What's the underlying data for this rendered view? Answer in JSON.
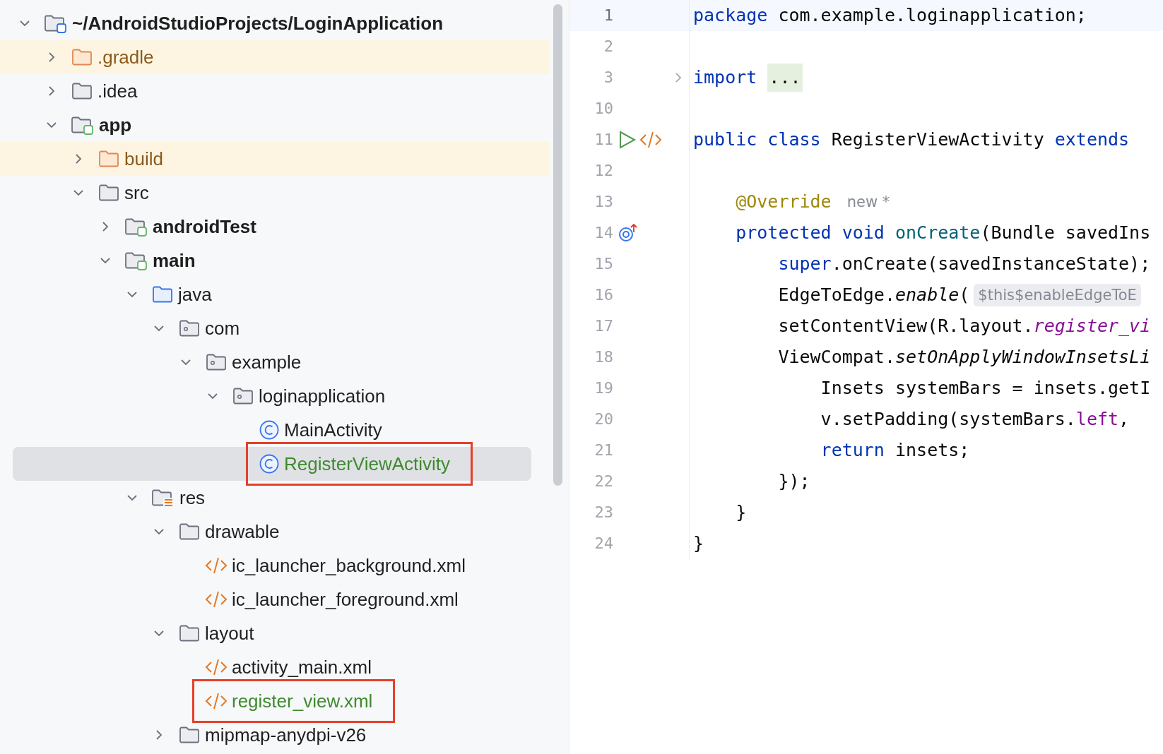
{
  "project_tree": {
    "root": {
      "label": "~/AndroidStudioProjects/LoginApplication",
      "kind": "project",
      "expanded": true,
      "excluded": false,
      "selected": false,
      "added": false,
      "boxed": false,
      "children": [
        {
          "label": ".gradle",
          "kind": "folder",
          "expanded": false,
          "excluded": true,
          "selected": false,
          "added": false,
          "boxed": false
        },
        {
          "label": ".idea",
          "kind": "folder",
          "expanded": false,
          "excluded": false,
          "selected": false,
          "added": false,
          "boxed": false
        },
        {
          "label": "app",
          "kind": "module",
          "expanded": true,
          "excluded": false,
          "selected": false,
          "added": false,
          "boxed": false,
          "children": [
            {
              "label": "build",
              "kind": "folder",
              "expanded": false,
              "excluded": true,
              "selected": false,
              "added": false,
              "boxed": false
            },
            {
              "label": "src",
              "kind": "folder",
              "expanded": true,
              "excluded": false,
              "selected": false,
              "added": false,
              "boxed": false,
              "children": [
                {
                  "label": "androidTest",
                  "kind": "module",
                  "expanded": false,
                  "excluded": false,
                  "selected": false,
                  "added": false,
                  "boxed": false
                },
                {
                  "label": "main",
                  "kind": "module",
                  "expanded": true,
                  "excluded": false,
                  "selected": false,
                  "added": false,
                  "boxed": false,
                  "children": [
                    {
                      "label": "java",
                      "kind": "source-root",
                      "expanded": true,
                      "excluded": false,
                      "selected": false,
                      "added": false,
                      "boxed": false,
                      "children": [
                        {
                          "label": "com",
                          "kind": "package",
                          "expanded": true,
                          "excluded": false,
                          "selected": false,
                          "added": false,
                          "boxed": false,
                          "children": [
                            {
                              "label": "example",
                              "kind": "package",
                              "expanded": true,
                              "excluded": false,
                              "selected": false,
                              "added": false,
                              "boxed": false,
                              "children": [
                                {
                                  "label": "loginapplication",
                                  "kind": "package",
                                  "expanded": true,
                                  "excluded": false,
                                  "selected": false,
                                  "added": false,
                                  "boxed": false,
                                  "children": [
                                    {
                                      "label": "MainActivity",
                                      "kind": "class",
                                      "excluded": false,
                                      "selected": false,
                                      "added": false,
                                      "boxed": false
                                    },
                                    {
                                      "label": "RegisterViewActivity",
                                      "kind": "class",
                                      "excluded": false,
                                      "selected": true,
                                      "added": true,
                                      "boxed": true
                                    }
                                  ]
                                }
                              ]
                            }
                          ]
                        }
                      ]
                    },
                    {
                      "label": "res",
                      "kind": "resources",
                      "expanded": true,
                      "excluded": false,
                      "selected": false,
                      "added": false,
                      "boxed": false,
                      "children": [
                        {
                          "label": "drawable",
                          "kind": "folder",
                          "expanded": true,
                          "excluded": false,
                          "selected": false,
                          "added": false,
                          "boxed": false,
                          "children": [
                            {
                              "label": "ic_launcher_background.xml",
                              "kind": "xml",
                              "excluded": false,
                              "selected": false,
                              "added": false,
                              "boxed": false
                            },
                            {
                              "label": "ic_launcher_foreground.xml",
                              "kind": "xml",
                              "excluded": false,
                              "selected": false,
                              "added": false,
                              "boxed": false
                            }
                          ]
                        },
                        {
                          "label": "layout",
                          "kind": "folder",
                          "expanded": true,
                          "excluded": false,
                          "selected": false,
                          "added": false,
                          "boxed": false,
                          "children": [
                            {
                              "label": "activity_main.xml",
                              "kind": "xml",
                              "excluded": false,
                              "selected": false,
                              "added": false,
                              "boxed": false
                            },
                            {
                              "label": "register_view.xml",
                              "kind": "xml",
                              "excluded": false,
                              "selected": false,
                              "added": true,
                              "boxed": true
                            }
                          ]
                        },
                        {
                          "label": "mipmap-anydpi-v26",
                          "kind": "folder",
                          "expanded": false,
                          "excluded": false,
                          "selected": false,
                          "added": false,
                          "boxed": false
                        }
                      ]
                    }
                  ]
                }
              ]
            }
          ]
        }
      ]
    }
  },
  "editor": {
    "lines": [
      {
        "num": "1",
        "current": true,
        "foldable": false,
        "tokens": [
          {
            "kind": "kw",
            "text": "package"
          },
          {
            "kind": "plain",
            "text": " com.example.loginapplication;"
          }
        ]
      },
      {
        "num": "2",
        "current": false,
        "foldable": false
      },
      {
        "num": "3",
        "current": false,
        "foldable": true,
        "tokens": [
          {
            "kind": "kw",
            "text": "import "
          },
          {
            "kind": "fold",
            "text": "..."
          }
        ]
      },
      {
        "num": "10",
        "current": false,
        "foldable": false
      },
      {
        "num": "11",
        "current": false,
        "foldable": false,
        "gutter": [
          {
            "kind": "run"
          },
          {
            "kind": "layout-link"
          }
        ],
        "tokens": [
          {
            "kind": "kw",
            "text": "public "
          },
          {
            "kind": "kw",
            "text": "class "
          },
          {
            "kind": "plain",
            "text": "RegisterViewActivity "
          },
          {
            "kind": "kw",
            "text": "extends"
          }
        ]
      },
      {
        "num": "12",
        "current": false,
        "foldable": false
      },
      {
        "num": "13",
        "current": false,
        "foldable": false,
        "tokens": [
          {
            "kind": "anno",
            "text": "    @Override"
          },
          {
            "kind": "author",
            "text": "new *"
          }
        ]
      },
      {
        "num": "14",
        "current": false,
        "foldable": false,
        "gutter": [
          {
            "kind": "override"
          }
        ],
        "tokens": [
          {
            "kind": "kw",
            "text": "    protected "
          },
          {
            "kind": "kw",
            "text": "void "
          },
          {
            "kind": "decl",
            "text": "onCreate"
          },
          {
            "kind": "plain",
            "text": "(Bundle savedIns"
          }
        ]
      },
      {
        "num": "15",
        "current": false,
        "foldable": false,
        "tokens": [
          {
            "kind": "kw",
            "text": "        super"
          },
          {
            "kind": "plain",
            "text": ".onCreate(savedInstanceState);"
          }
        ]
      },
      {
        "num": "16",
        "current": false,
        "foldable": false,
        "tokens": [
          {
            "kind": "plain",
            "text": "        EdgeToEdge."
          },
          {
            "kind": "static",
            "text": "enable"
          },
          {
            "kind": "plain",
            "text": "("
          },
          {
            "kind": "inlay",
            "text": "$this$enableEdgeToE"
          }
        ]
      },
      {
        "num": "17",
        "current": false,
        "foldable": false,
        "tokens": [
          {
            "kind": "plain",
            "text": "        setContentView(R.layout."
          },
          {
            "kind": "static-field",
            "text": "register_vi"
          }
        ]
      },
      {
        "num": "18",
        "current": false,
        "foldable": false,
        "tokens": [
          {
            "kind": "plain",
            "text": "        ViewCompat."
          },
          {
            "kind": "static",
            "text": "setOnApplyWindowInsetsLi"
          }
        ]
      },
      {
        "num": "19",
        "current": false,
        "foldable": false,
        "tokens": [
          {
            "kind": "plain",
            "text": "            Insets systemBars = insets.getI"
          }
        ]
      },
      {
        "num": "20",
        "current": false,
        "foldable": false,
        "tokens": [
          {
            "kind": "plain",
            "text": "            v.setPadding(systemBars."
          },
          {
            "kind": "field",
            "text": "left"
          },
          {
            "kind": "plain",
            "text": ","
          }
        ]
      },
      {
        "num": "21",
        "current": false,
        "foldable": false,
        "tokens": [
          {
            "kind": "kw",
            "text": "            return"
          },
          {
            "kind": "plain",
            "text": " insets;"
          }
        ]
      },
      {
        "num": "22",
        "current": false,
        "foldable": false,
        "tokens": [
          {
            "kind": "plain",
            "text": "        });"
          }
        ]
      },
      {
        "num": "23",
        "current": false,
        "foldable": false,
        "tokens": [
          {
            "kind": "plain",
            "text": "    }"
          }
        ]
      },
      {
        "num": "24",
        "current": false,
        "foldable": false,
        "tokens": [
          {
            "kind": "plain",
            "text": "}"
          }
        ]
      }
    ]
  }
}
